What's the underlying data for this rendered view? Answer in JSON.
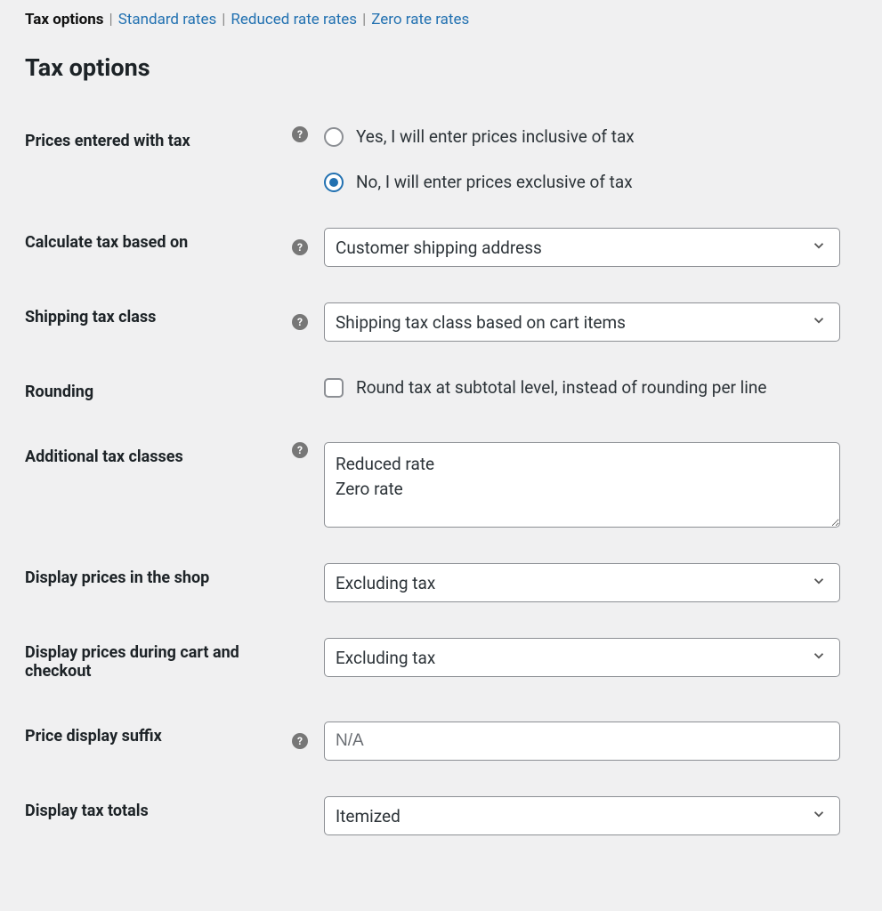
{
  "subnav": {
    "current": "Tax options",
    "links": [
      "Standard rates",
      "Reduced rate rates",
      "Zero rate rates"
    ]
  },
  "section_title": "Tax options",
  "fields": {
    "prices_entered": {
      "label": "Prices entered with tax",
      "options": {
        "yes": "Yes, I will enter prices inclusive of tax",
        "no": "No, I will enter prices exclusive of tax"
      },
      "selected": "no"
    },
    "calc_based": {
      "label": "Calculate tax based on",
      "value": "Customer shipping address"
    },
    "ship_class": {
      "label": "Shipping tax class",
      "value": "Shipping tax class based on cart items"
    },
    "rounding": {
      "label": "Rounding",
      "checkbox_label": "Round tax at subtotal level, instead of rounding per line",
      "checked": false
    },
    "add_classes": {
      "label": "Additional tax classes",
      "value": "Reduced rate\nZero rate"
    },
    "display_shop": {
      "label": "Display prices in the shop",
      "value": "Excluding tax"
    },
    "display_cart": {
      "label": "Display prices during cart and checkout",
      "value": "Excluding tax"
    },
    "price_suffix": {
      "label": "Price display suffix",
      "placeholder": "N/A",
      "value": ""
    },
    "tax_totals": {
      "label": "Display tax totals",
      "value": "Itemized"
    }
  }
}
